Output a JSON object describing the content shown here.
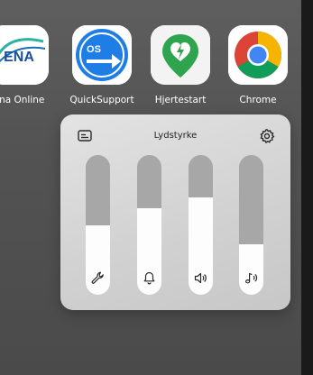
{
  "apps": [
    {
      "label": "ena Online",
      "icon": "ena-online-icon"
    },
    {
      "label": "QuickSupport",
      "icon": "quicksupport-icon"
    },
    {
      "label": "Hjertestart",
      "icon": "hjertestart-icon"
    },
    {
      "label": "Chrome",
      "icon": "chrome-icon"
    }
  ],
  "panel": {
    "title": "Lydstyrke",
    "sliders": [
      {
        "icon": "wrench-icon",
        "level": 0.5
      },
      {
        "icon": "bell-icon",
        "level": 0.62
      },
      {
        "icon": "speaker-icon",
        "level": 0.7
      },
      {
        "icon": "music-note-icon",
        "level": 0.36
      }
    ]
  },
  "colors": {
    "panel": "#d6d6d6",
    "track": "#a7a7a7",
    "fill": "#fdfdfd"
  }
}
